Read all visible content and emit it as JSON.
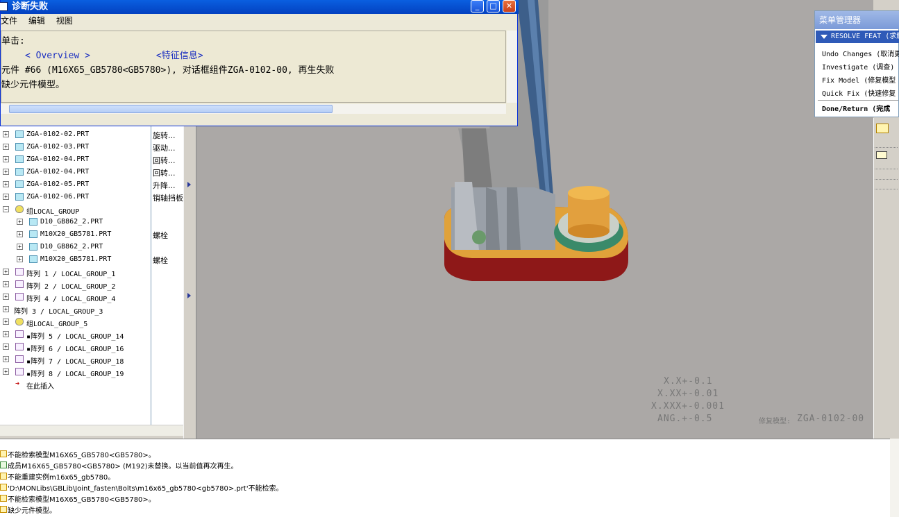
{
  "dialog": {
    "title": "诊断失败",
    "menu": [
      "文件",
      "编辑",
      "视图"
    ],
    "lines": {
      "click": "单击:",
      "overview": "< Overview >",
      "feature_info": "<特征信息>",
      "line2": "元件 #66 (M16X65_GB5780<GB5780>), 对话框组件ZGA-0102-00, 再生失败",
      "line3": "缺少元件模型。"
    }
  },
  "tree": [
    {
      "label": "ZGA-0102-02.PRT",
      "col2": "旋转...",
      "icon": "part",
      "indent": 0
    },
    {
      "label": "ZGA-0102-03.PRT",
      "col2": "驱动...",
      "icon": "part",
      "indent": 0
    },
    {
      "label": "ZGA-0102-04.PRT",
      "col2": "回转...",
      "icon": "part",
      "indent": 0
    },
    {
      "label": "ZGA-0102-04.PRT",
      "col2": "回转...",
      "icon": "part",
      "indent": 0
    },
    {
      "label": "ZGA-0102-05.PRT",
      "col2": "升降...",
      "icon": "part",
      "indent": 0
    },
    {
      "label": "ZGA-0102-06.PRT",
      "col2": "销轴挡板",
      "icon": "part",
      "indent": 0
    },
    {
      "label": "组LOCAL_GROUP",
      "col2": "",
      "icon": "group",
      "indent": 0,
      "expanded": true
    },
    {
      "label": "D10_GB862_2.PRT",
      "col2": "",
      "icon": "part",
      "indent": 1
    },
    {
      "label": "M10X20_GB5781.PRT",
      "col2": "螺栓",
      "icon": "part",
      "indent": 1
    },
    {
      "label": "D10_GB862_2.PRT",
      "col2": "",
      "icon": "part",
      "indent": 1
    },
    {
      "label": "M10X20_GB5781.PRT",
      "col2": "螺栓",
      "icon": "part",
      "indent": 1
    },
    {
      "label": "阵列 1 / LOCAL_GROUP_1",
      "col2": "",
      "icon": "pattern",
      "indent": 0
    },
    {
      "label": "阵列 2 / LOCAL_GROUP_2",
      "col2": "",
      "icon": "pattern",
      "indent": 0
    },
    {
      "label": "阵列 4 / LOCAL_GROUP_4",
      "col2": "",
      "icon": "pattern",
      "indent": 0
    },
    {
      "label": "阵列 3 / LOCAL_GROUP_3",
      "col2": "",
      "icon": "none",
      "indent": 0
    },
    {
      "label": "组LOCAL_GROUP_5",
      "col2": "",
      "icon": "group",
      "indent": 0
    },
    {
      "label": "▪阵列 5 / LOCAL_GROUP_14",
      "col2": "",
      "icon": "pattern",
      "indent": 0
    },
    {
      "label": "▪阵列 6 / LOCAL_GROUP_16",
      "col2": "",
      "icon": "pattern",
      "indent": 0
    },
    {
      "label": "▪阵列 7 / LOCAL_GROUP_18",
      "col2": "",
      "icon": "pattern",
      "indent": 0
    },
    {
      "label": "▪阵列 8 / LOCAL_GROUP_19",
      "col2": "",
      "icon": "pattern",
      "indent": 0
    }
  ],
  "insert_here": "在此插入",
  "menu_manager": {
    "title": "菜单管理器",
    "header": "RESOLVE FEAT (求解",
    "items": [
      "Undo Changes (取消更",
      "Investigate (调查)",
      "Fix Model (修复模型",
      "Quick Fix (快速修复"
    ],
    "done": "Done/Return (完成"
  },
  "viewport": {
    "tolerances": [
      "X.X+-0.1",
      "X.XX+-0.01",
      "X.XXX+-0.001",
      "ANG.+-0.5"
    ],
    "fix_label": "修复模型:",
    "model_name": "ZGA-0102-00"
  },
  "messages": [
    {
      "text": "不能检索模型M16X65_GB5780<GB5780>。",
      "icon": "warn"
    },
    {
      "text": "成员M16X65_GB5780<GB5780> (M192)未替换。以当前值再次再生。",
      "icon": "info"
    },
    {
      "text": "不能重建实例m16x65_gb5780。",
      "icon": "warn"
    },
    {
      "text": "'D:\\MONLibs\\GBLib\\Joint_fasten\\Bolts\\m16x65_gb5780<gb5780>.prt'不能检索。",
      "icon": "warn"
    },
    {
      "text": "不能检索模型M16X65_GB5780<GB5780>。",
      "icon": "warn"
    },
    {
      "text": "缺少元件模型。",
      "icon": "warn"
    }
  ]
}
